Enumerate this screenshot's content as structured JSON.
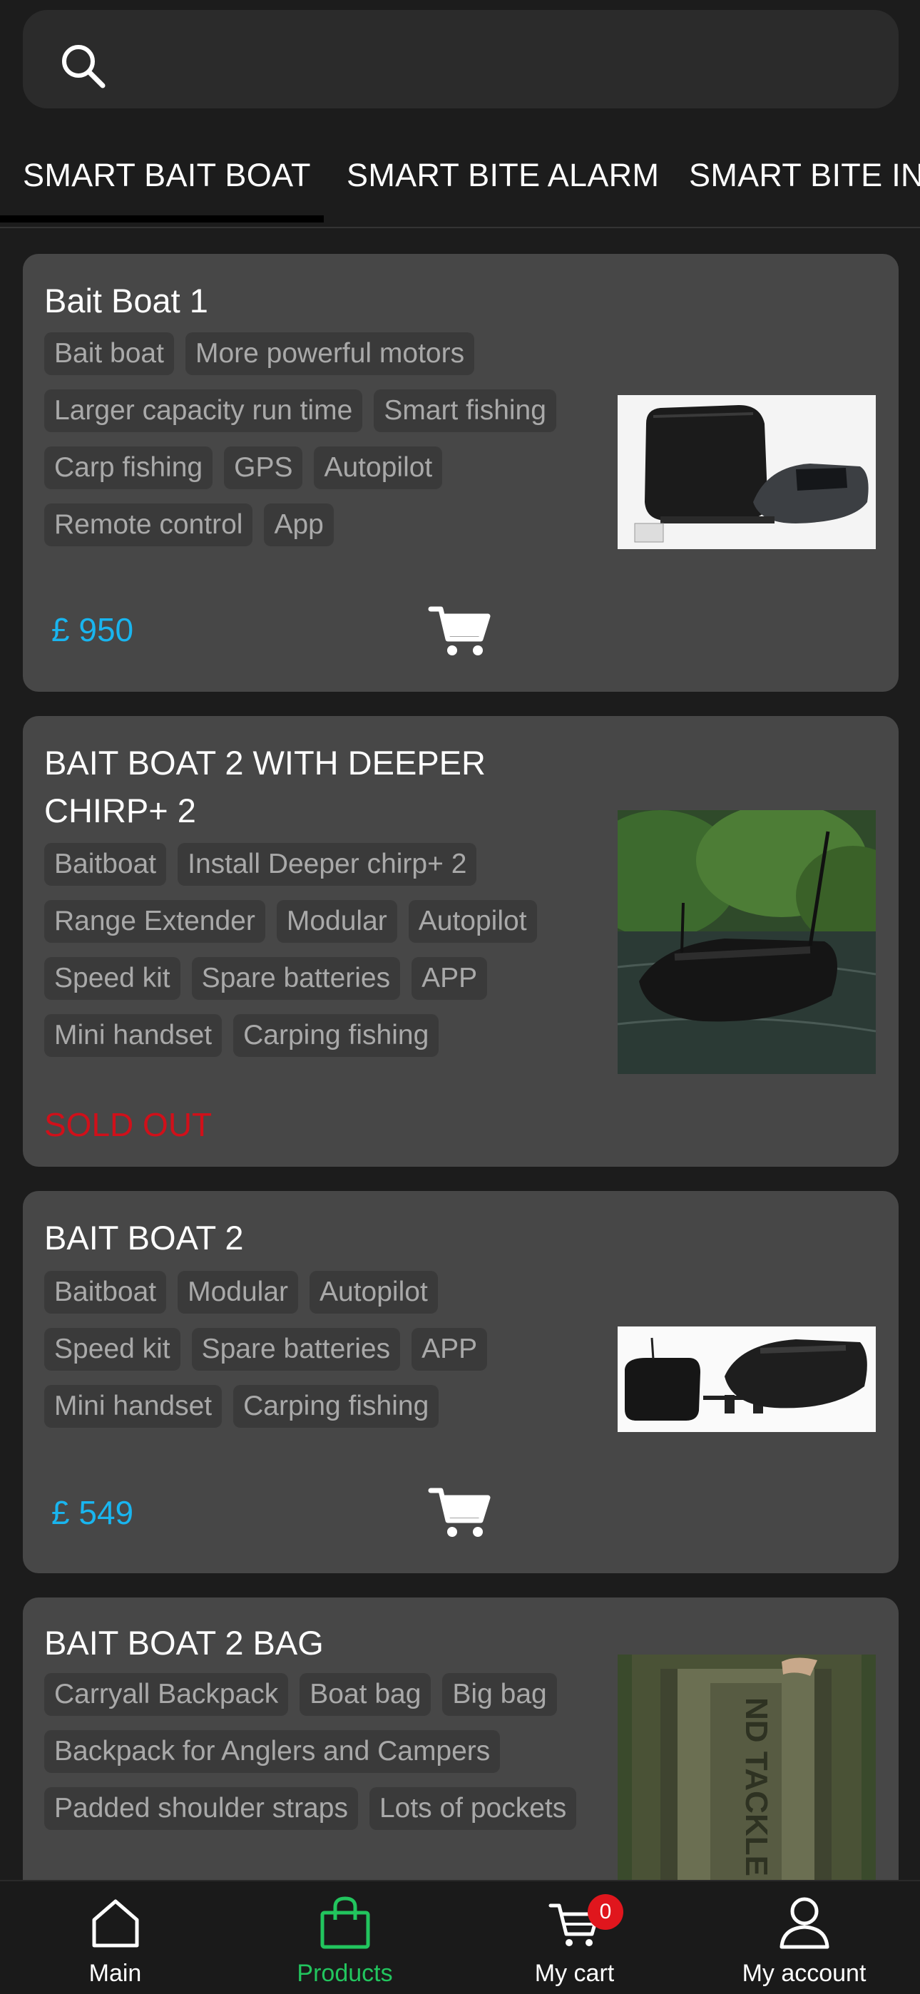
{
  "search": {
    "placeholder": ""
  },
  "tabs": [
    {
      "label": "SMART BAIT BOAT",
      "active": true
    },
    {
      "label": "SMART BITE ALARM",
      "active": false
    },
    {
      "label": "SMART BITE IND",
      "active": false
    }
  ],
  "products": [
    {
      "title": "Bait Boat 1",
      "tag_rows": [
        [
          "Bait boat",
          "More powerful motors"
        ],
        [
          "Larger capacity run time",
          "Smart fishing"
        ],
        [
          "Carp fishing",
          "GPS",
          "Autopilot"
        ],
        [
          "Remote control",
          "App"
        ]
      ],
      "price": "£ 950",
      "status": "",
      "image": "bait-boat-with-case-photo"
    },
    {
      "title": "BAIT BOAT 2 WITH DEEPER CHIRP+ 2",
      "tag_rows": [
        [
          "Baitboat",
          "Install Deeper chirp+ 2"
        ],
        [
          "Range Extender",
          "Modular",
          "Autopilot"
        ],
        [
          "Speed kit",
          "Spare batteries",
          "APP"
        ],
        [
          "Mini handset",
          "Carping fishing"
        ]
      ],
      "price": "",
      "status": "SOLD OUT",
      "image": "bait-boat-on-lake-photo"
    },
    {
      "title": "BAIT BOAT 2",
      "tag_rows": [
        [
          "Baitboat",
          "Modular",
          "Autopilot"
        ],
        [
          "Speed kit",
          "Spare batteries",
          "APP"
        ],
        [
          "Mini handset",
          "Carping fishing"
        ]
      ],
      "price": "£ 549",
      "status": "",
      "image": "bait-boat-kit-photo"
    },
    {
      "title": "BAIT BOAT 2 BAG",
      "tag_rows": [
        [
          "Carryall Backpack",
          "Boat bag",
          "Big bag"
        ],
        [
          "Backpack for Anglers and Campers"
        ],
        [
          "Padded shoulder straps",
          "Lots of pockets"
        ]
      ],
      "price": "",
      "status": "",
      "image": "backpack-photo"
    }
  ],
  "bottom_nav": [
    {
      "label": "Main",
      "icon": "home-icon",
      "active": false
    },
    {
      "label": "Products",
      "icon": "shopping-bag-icon",
      "active": true
    },
    {
      "label": "My cart",
      "icon": "cart-icon",
      "active": false,
      "badge": "0"
    },
    {
      "label": "My account",
      "icon": "user-icon",
      "active": false
    }
  ],
  "colors": {
    "price": "#19b5ef",
    "sold_out": "#d0101a",
    "active_nav": "#22c55e",
    "badge": "#e0161d"
  }
}
